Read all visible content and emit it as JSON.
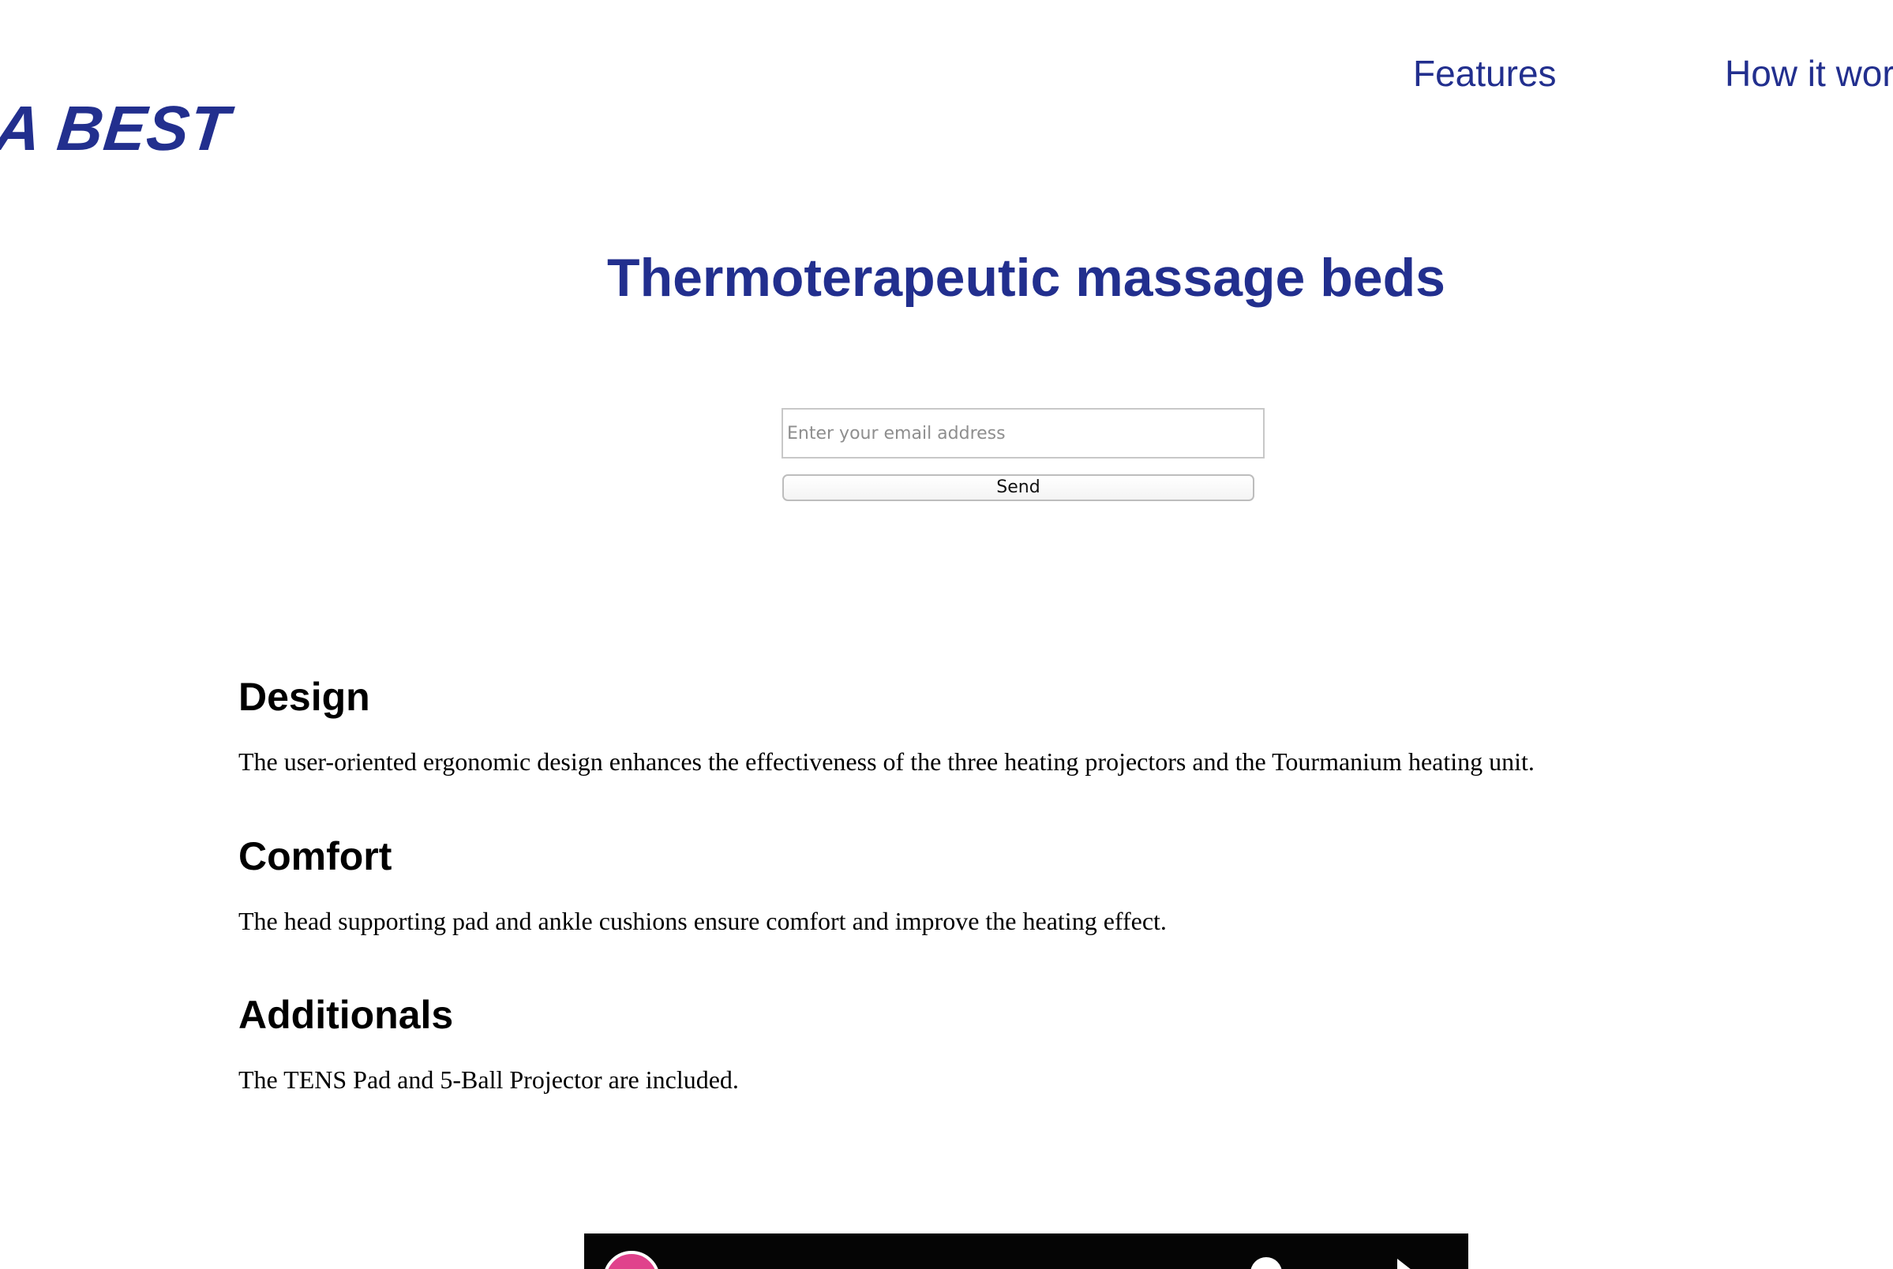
{
  "header": {
    "logo_text": "A BEST",
    "nav": {
      "features": "Features",
      "how_it_works": "How it works"
    }
  },
  "hero": {
    "title": "Thermoterapeutic massage beds",
    "email_placeholder": "Enter your email address",
    "email_value": "",
    "send_label": "Send"
  },
  "features": {
    "design": {
      "title": "Design",
      "text": "The user-oriented ergonomic design enhances the effectiveness of the three heating projectors and the Tourmanium heating unit."
    },
    "comfort": {
      "title": "Comfort",
      "text": "The head supporting pad and ankle cushions ensure comfort and improve the heating effect."
    },
    "additionals": {
      "title": "Additionals",
      "text": "The TENS Pad and 5-Ball Projector are included."
    }
  },
  "video": {
    "icons": [
      "channel-avatar-icon",
      "info-icon",
      "share-icon"
    ]
  },
  "colors": {
    "brand": "#222f8e",
    "text": "#000000",
    "background": "#ffffff"
  }
}
